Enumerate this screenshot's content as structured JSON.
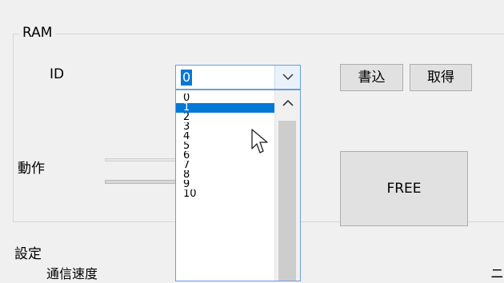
{
  "ram_group": {
    "title": "RAM",
    "id_label": "ID",
    "action_label": "動作",
    "id_combo": {
      "value": "0"
    },
    "write_button": "書込",
    "get_button": "取得",
    "free_button": "FREE",
    "dropdown_items": [
      "0",
      "1",
      "2",
      "3",
      "4",
      "5",
      "6",
      "7",
      "8",
      "9",
      "10"
    ],
    "selected_index": 1
  },
  "settings_group": {
    "title": "設定",
    "comm_speed_label": "通信速度",
    "right_edge_text": "ニ"
  },
  "icons": {
    "combo_arrow": "chevron-down-icon",
    "scroll_up": "chevron-up-icon",
    "cursor": "arrow-cursor-icon"
  },
  "colors": {
    "selection": "#0078d7",
    "accent_border": "#6a9ed8",
    "window_bg": "#f0f0f0"
  }
}
